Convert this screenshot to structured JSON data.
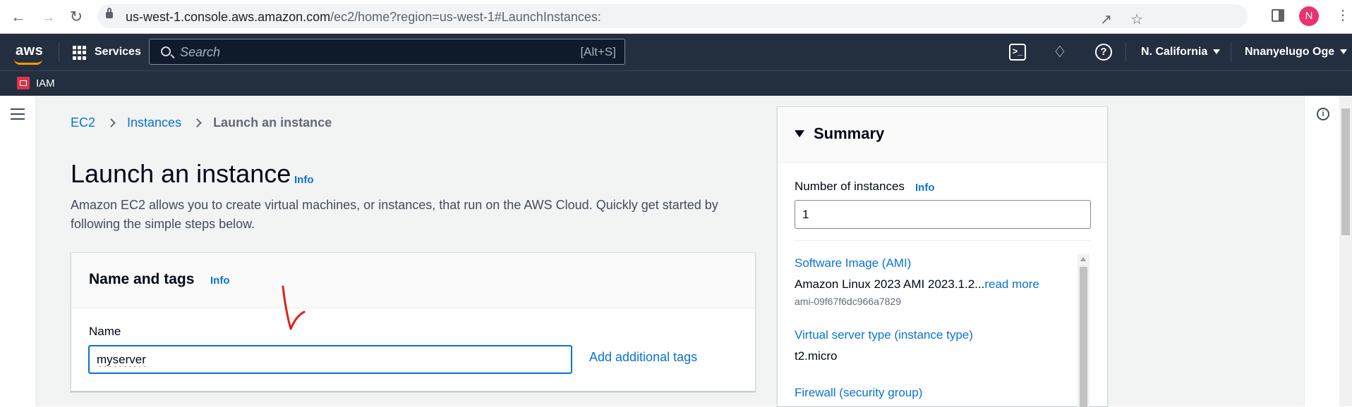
{
  "browser": {
    "url_host": "us-west-1.console.aws.amazon.com",
    "url_path": "/ec2/home?region=us-west-1#LaunchInstances:",
    "avatar_letter": "N"
  },
  "aws_nav": {
    "logo": "aws",
    "services_label": "Services",
    "search_placeholder": "Search",
    "search_shortcut": "[Alt+S]",
    "region_label": "N. California",
    "account_label": "Nnanyelugo Oge",
    "favorite_service": "IAM",
    "brand_color": "#232f3e",
    "accent_color": "#ff9900"
  },
  "breadcrumb": {
    "items": [
      "EC2",
      "Instances"
    ],
    "current": "Launch an instance"
  },
  "page": {
    "title": "Launch an instance",
    "info_label": "Info",
    "description": "Amazon EC2 allows you to create virtual machines, or instances, that run on the AWS Cloud. Quickly get started by following the simple steps below."
  },
  "name_and_tags": {
    "title": "Name and tags",
    "info_label": "Info",
    "name_label": "Name",
    "name_value": "myserver",
    "add_tags_label": "Add additional tags"
  },
  "summary": {
    "title": "Summary",
    "num_instances_label": "Number of instances",
    "info_label": "Info",
    "num_instances_value": "1",
    "ami_link": "Software Image (AMI)",
    "ami_value": "Amazon Linux 2023 AMI 2023.1.2...",
    "read_more": "read more",
    "ami_id": "ami-09f67f6dc966a7829",
    "instance_type_link": "Virtual server type (instance type)",
    "instance_type_value": "t2.micro",
    "firewall_link": "Firewall (security group)"
  },
  "icons": {
    "back": "arrow-left-icon",
    "forward": "arrow-right-icon",
    "reload": "reload-icon",
    "share": "share-icon",
    "bookmark": "star-icon",
    "menu": "hamburger-icon",
    "info": "info-circle-icon"
  }
}
